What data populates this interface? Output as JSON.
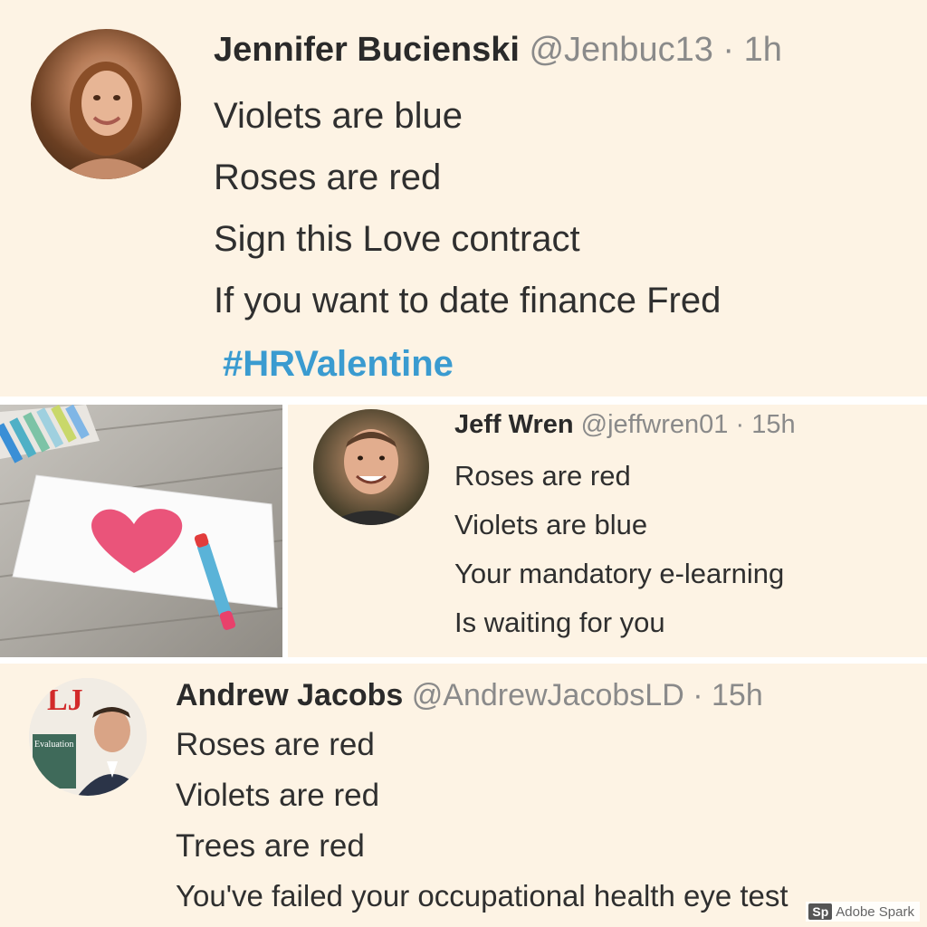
{
  "tweets": [
    {
      "name": "Jennifer Bucienski",
      "handle": "@Jenbuc13",
      "separator": "·",
      "time": "1h",
      "lines": [
        "Violets are blue",
        "Roses are red",
        "Sign this Love contract",
        "If you want to date finance Fred"
      ],
      "hashtag": "#HRValentine"
    },
    {
      "name": "Jeff Wren",
      "handle": "@jeffwren01",
      "separator": "·",
      "time": "15h",
      "lines": [
        "Roses are red",
        "Violets are blue",
        "Your mandatory e-learning",
        "Is waiting for you"
      ]
    },
    {
      "name": "Andrew Jacobs",
      "handle": "@AndrewJacobsLD",
      "separator": "·",
      "time": "15h",
      "lines": [
        "Roses are red",
        "Violets are red",
        "Trees are red",
        "You've failed your occupational health eye test"
      ],
      "avatar_badge": "LJ",
      "avatar_cover_text": "Evaluation"
    }
  ],
  "watermark": {
    "badge": "Sp",
    "text": "Adobe Spark"
  },
  "colors": {
    "panel_bg": "#fdf3e4",
    "hashtag": "#3a9bd0",
    "heart": "#e8416b"
  },
  "icons": [
    "avatar-photo",
    "heart-drawing",
    "crayon",
    "adobe-spark-logo"
  ]
}
